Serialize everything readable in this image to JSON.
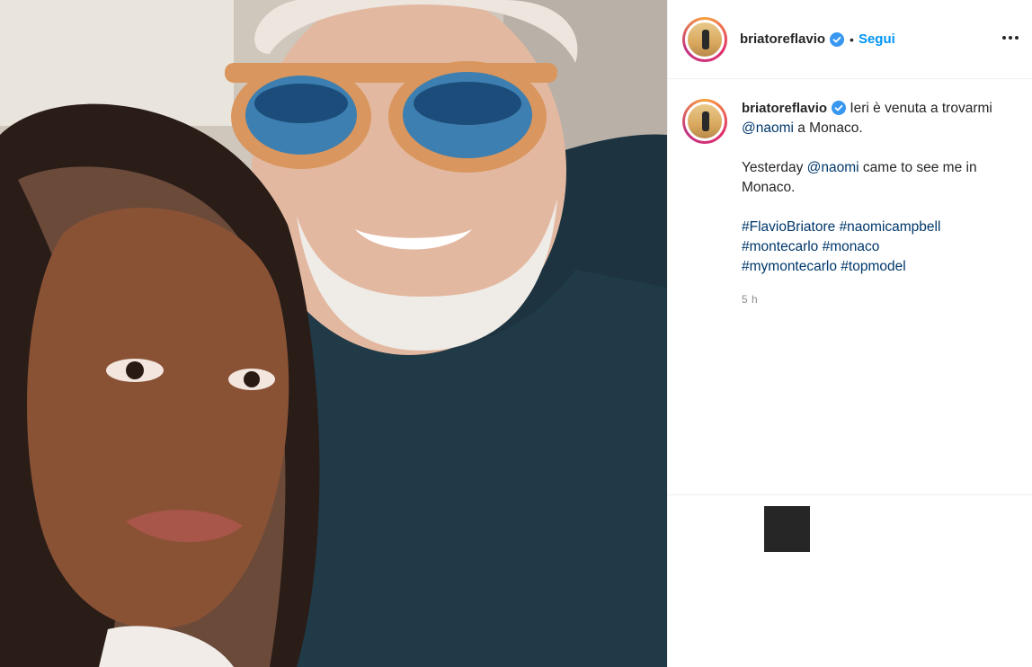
{
  "post": {
    "image_alt": "Selfie di briatoreflavio con naomi",
    "username": "briatoreflavio",
    "verified": true,
    "follow_separator": "•",
    "follow_label": "Segui",
    "caption": {
      "line1_prefix": "Ieri è venuta a trovarmi ",
      "line1_mention": "@naomi",
      "line1_suffix": " a Monaco.",
      "line2_prefix": "Yesterday ",
      "line2_mention": "@naomi",
      "line2_suffix": " came to see me in Monaco.",
      "hashtags": [
        "#FlavioBriatore",
        "#naomicampbell",
        "#montecarlo",
        "#monaco",
        "#mymontecarlo",
        "#topmodel"
      ]
    },
    "timestamp": "5 h"
  },
  "colors": {
    "accent": "#0095f6",
    "link": "#00376b",
    "verified": "#3897f0"
  },
  "icons": {
    "verified": "verified-badge-icon",
    "more": "more-options-icon"
  }
}
